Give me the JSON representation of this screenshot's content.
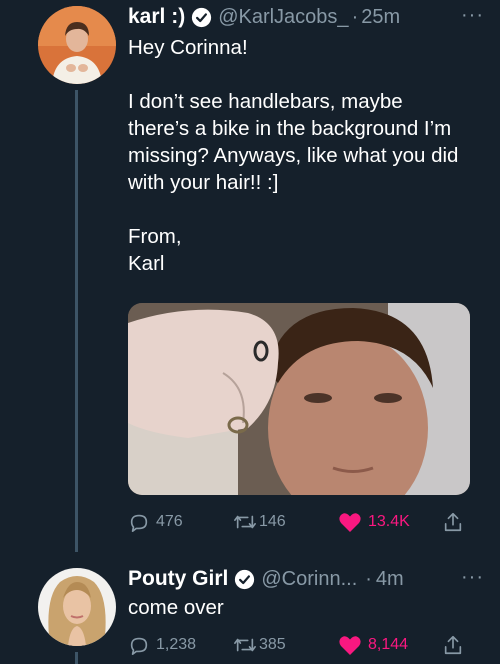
{
  "tweets": [
    {
      "display_name": "karl :)",
      "handle": "@KarlJacobs_",
      "dot": "·",
      "time": "25m",
      "more": "···",
      "body_lines": [
        "Hey Corinna!",
        "",
        "I don't see handlebars, maybe there's a bike in the background I'm missing? Anyways, like what you did with your hair!! :]",
        "",
        "From,",
        "Karl"
      ],
      "body": {
        "p1": "Hey Corinna!",
        "p2": "I don’t see handlebars, maybe there’s a bike in the background I’m missing? Anyways, like what you did with your hair!! :]",
        "p3a": "From,",
        "p3b": "Karl"
      },
      "actions": {
        "replies": "476",
        "retweets": "146",
        "likes": "13.4K"
      },
      "liked": true
    },
    {
      "display_name": "Pouty Girl",
      "handle": "@Corinn...",
      "dot": "·",
      "time": "4m",
      "more": "···",
      "body": {
        "p1": "come over"
      },
      "actions": {
        "replies": "1,238",
        "retweets": "385",
        "likes": "8,144"
      },
      "liked": true
    }
  ],
  "colors": {
    "background": "#15202b",
    "secondary_text": "#8899a6",
    "like": "#f91880",
    "verified": "#ffffff",
    "thread_line": "#3d5466"
  },
  "icons": [
    "verified-badge-icon",
    "more-icon",
    "reply-icon",
    "retweet-icon",
    "like-icon",
    "share-icon"
  ]
}
